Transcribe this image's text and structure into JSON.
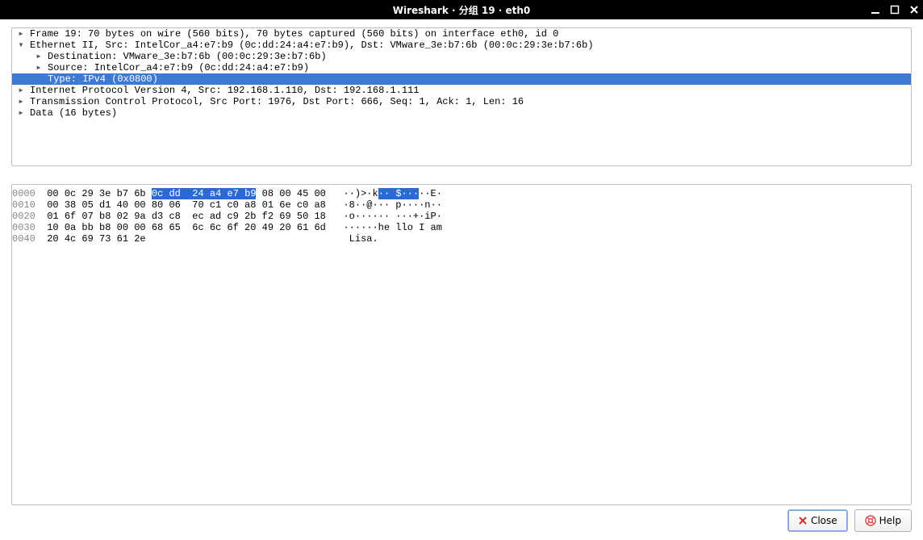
{
  "window": {
    "title": "Wireshark · 分组 19 · eth0"
  },
  "tree": {
    "frame": {
      "label": "Frame 19: 70 bytes on wire (560 bits), 70 bytes captured (560 bits) on interface eth0, id 0"
    },
    "eth": {
      "label": "Ethernet II, Src: IntelCor_a4:e7:b9 (0c:dd:24:a4:e7:b9), Dst: VMware_3e:b7:6b (00:0c:29:3e:b7:6b)",
      "dst": "Destination: VMware_3e:b7:6b (00:0c:29:3e:b7:6b)",
      "src": "Source: IntelCor_a4:e7:b9 (0c:dd:24:a4:e7:b9)",
      "type": "Type: IPv4 (0x0800)"
    },
    "ip": {
      "label": "Internet Protocol Version 4, Src: 192.168.1.110, Dst: 192.168.1.111"
    },
    "tcp": {
      "label": "Transmission Control Protocol, Src Port: 1976, Dst Port: 666, Seq: 1, Ack: 1, Len: 16"
    },
    "data": {
      "label": "Data (16 bytes)"
    }
  },
  "hex": {
    "row0": {
      "offset": "0000",
      "pre": "  00 0c 29 3e b7 6b ",
      "hl": "0c dd  24 a4 e7 b9",
      "post": " 08 00 45 00   ",
      "asc_pre": "··)>·k",
      "asc_hl": "·· $···",
      "asc_post": "··E·"
    },
    "row1": {
      "offset": "0010",
      "text": "  00 38 05 d1 40 00 80 06  70 c1 c0 a8 01 6e c0 a8   ·8··@··· p····n··"
    },
    "row2": {
      "offset": "0020",
      "text": "  01 6f 07 b8 02 9a d3 c8  ec ad c9 2b f2 69 50 18   ·o······ ···+·iP·"
    },
    "row3": {
      "offset": "0030",
      "text": "  10 0a bb b8 00 00 68 65  6c 6c 6f 20 49 20 61 6d   ······he llo I am"
    },
    "row4": {
      "offset": "0040",
      "text": "  20 4c 69 73 61 2e                                   Lisa.          "
    }
  },
  "buttons": {
    "close": "Close",
    "help": "Help"
  }
}
